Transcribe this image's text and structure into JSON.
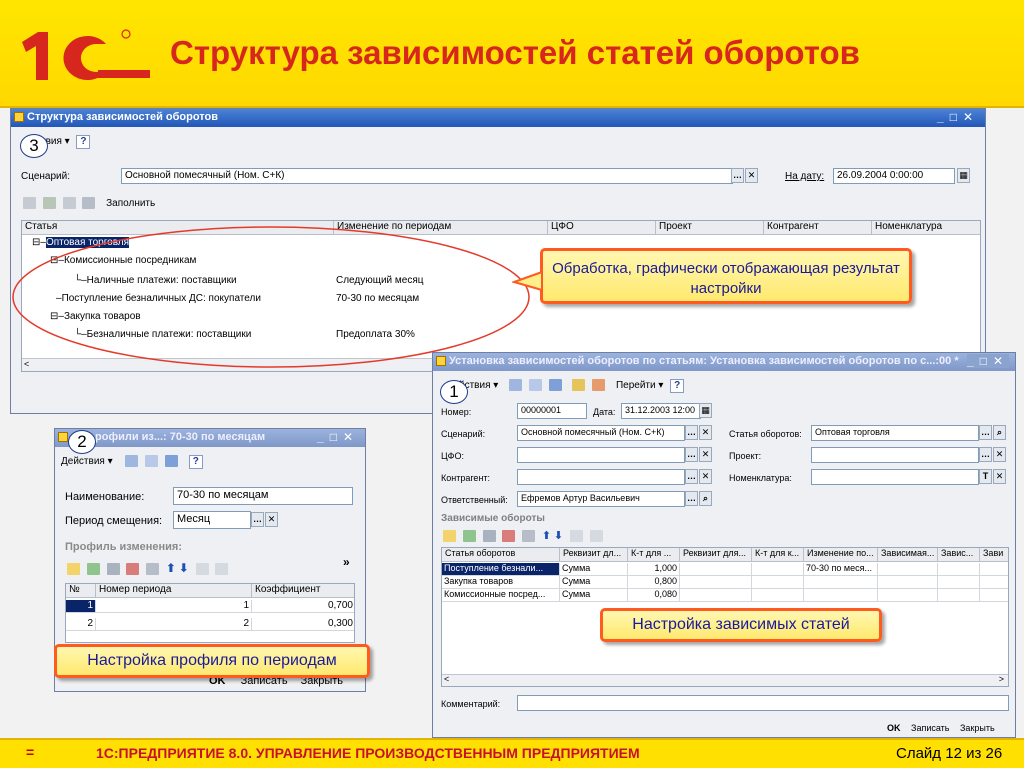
{
  "slide": {
    "title": "Структура зависимостей статей оборотов",
    "footer_marker": "=",
    "footer_text": "1С:ПРЕДПРИЯТИЕ 8.0. УПРАВЛЕНИЕ ПРОИЗВОДСТВЕННЫМ ПРЕДПРИЯТИЕМ",
    "slide_number": "Слайд 12 из 26",
    "logo_alt": "1С"
  },
  "colors": {
    "accent_red": "#d7261d",
    "band_yellow": "#ffe000",
    "callout_border": "#ff5a1f",
    "selection": "#0a246a"
  },
  "main_window": {
    "title": "Структура зависимостей оборотов",
    "menu_actions": "твия ▾",
    "help": "?",
    "scenario_label": "Сценарий:",
    "scenario_value": "Основной помесячный (Ном. С+К)",
    "date_label": "На дату:",
    "date_value": "26.09.2004  0:00:00",
    "fill_label": "Заполнить",
    "columns": [
      "Статья",
      "Изменение по периодам",
      "ЦФО",
      "Проект",
      "Контрагент",
      "Номенклатура"
    ],
    "tree": [
      {
        "label": "Оптовая торговля",
        "change": ""
      },
      {
        "label": "Комиссионные посредникам",
        "change": ""
      },
      {
        "label": "Наличные платежи: поставщики",
        "change": "Следующий месяц"
      },
      {
        "label": "Поступление безналичных ДС: покупатели",
        "change": "70-30 по месяцам"
      },
      {
        "label": "Закупка товаров",
        "change": ""
      },
      {
        "label": "Безналичные платежи: поставщики",
        "change": "Предоплата 30%"
      }
    ]
  },
  "callouts": {
    "graphic": "Обработка, графически отображающая результат настройки",
    "dependent": "Настройка зависимых статей",
    "profile": "Настройка профиля по периодам"
  },
  "badges": {
    "one": "1",
    "two": "2",
    "three": "3"
  },
  "profile_window": {
    "title": "рофили из...: 70-30 по месяцам",
    "actions": "Действия ▾",
    "help": "?",
    "name_label": "Наименование:",
    "name_value": "70-30 по месяцам",
    "period_label": "Период смещения:",
    "period_value": "Месяц",
    "section": "Профиль изменения:",
    "more": "»",
    "columns": [
      "№",
      "Номер периода",
      "Коэффициент"
    ],
    "rows": [
      {
        "n": "1",
        "period": "1",
        "coef": "0,700"
      },
      {
        "n": "2",
        "period": "2",
        "coef": "0,300"
      }
    ],
    "ok": "OK",
    "save": "Записать",
    "close": "Закрыть"
  },
  "deps_window": {
    "title": "Установка зависимостей оборотов по статьям: Установка зависимостей оборотов по с...:00 *",
    "actions": "йствия ▾",
    "goto": "Перейти ▾",
    "help": "?",
    "number_label": "Номер:",
    "number_value": "00000001",
    "date_label": "Дата:",
    "date_value": "31.12.2003 12:00",
    "scenario_label": "Сценарий:",
    "scenario_value": "Основной помесячный (Ном. С+К)",
    "article_label": "Статья оборотов:",
    "article_value": "Оптовая торговля",
    "cfo_label": "ЦФО:",
    "project_label": "Проект:",
    "counterparty_label": "Контрагент:",
    "nomenclature_label": "Номенклатура:",
    "responsible_label": "Ответственный:",
    "responsible_value": "Ефремов Артур Васильевич",
    "section": "Зависимые обороты",
    "columns": [
      "Статья оборотов",
      "Реквизит дл...",
      "К-т  для ...",
      "Реквизит для...",
      "К-т для к...",
      "Изменение по...",
      "Зависимая...",
      "Завис...",
      "Зави"
    ],
    "rows": [
      {
        "article": "Поступление безнали...",
        "req": "Сумма",
        "coef": "1,000",
        "change": "70-30 по меся..."
      },
      {
        "article": "Закупка товаров",
        "req": "Сумма",
        "coef": "0,800",
        "change": ""
      },
      {
        "article": "Комиссионные посред...",
        "req": "Сумма",
        "coef": "0,080",
        "change": ""
      }
    ],
    "comment_label": "Комментарий:",
    "ok": "OK",
    "save": "Записать",
    "close": "Закрыть"
  }
}
